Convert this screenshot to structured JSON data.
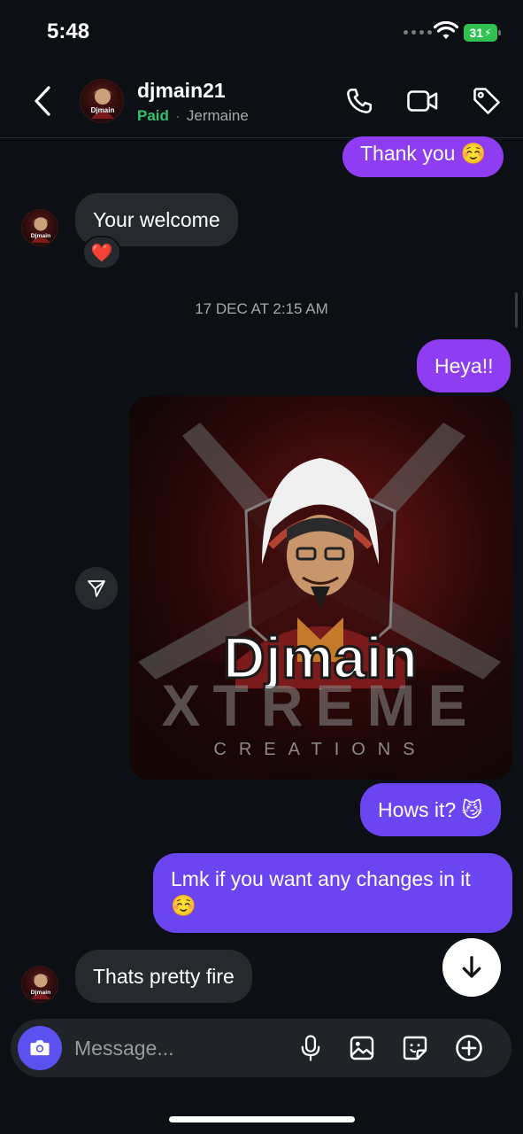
{
  "status_bar": {
    "time": "5:48",
    "battery": "31"
  },
  "header": {
    "username": "djmain21",
    "status": "Paid",
    "separator": "·",
    "full_name": "Jermaine"
  },
  "messages": {
    "m1": "Thank you ☺️",
    "m2": "Your welcome",
    "m2_reaction": "❤️",
    "timestamp": "17 DEC AT 2:15 AM",
    "m3": "Heya!!",
    "image": {
      "line1": "Djmain",
      "line2": "XTREME",
      "line3": "CREATIONS"
    },
    "m4": "Hows it? 😼",
    "m5_line1": "Lmk if you want any changes in it",
    "m5_line2": "☺️",
    "m6": "Thats pretty fire"
  },
  "avatar": {
    "label": "Djmain"
  },
  "composer": {
    "placeholder": "Message..."
  },
  "colors": {
    "background": "#0c1014",
    "incoming_bubble": "#262a2e",
    "outgoing_purple": "#8e3df2",
    "outgoing_violet": "#6c45f2",
    "paid_green": "#2ec26a",
    "camera_button": "#5b51f0"
  },
  "icons": {
    "back": "chevron-left-icon",
    "call": "phone-icon",
    "video": "video-camera-icon",
    "tag": "tag-icon",
    "share": "paper-plane-icon",
    "scroll": "arrow-down-icon",
    "camera": "camera-icon",
    "mic": "microphone-icon",
    "gallery": "image-icon",
    "sticker": "sticker-icon",
    "add": "plus-circle-icon"
  }
}
